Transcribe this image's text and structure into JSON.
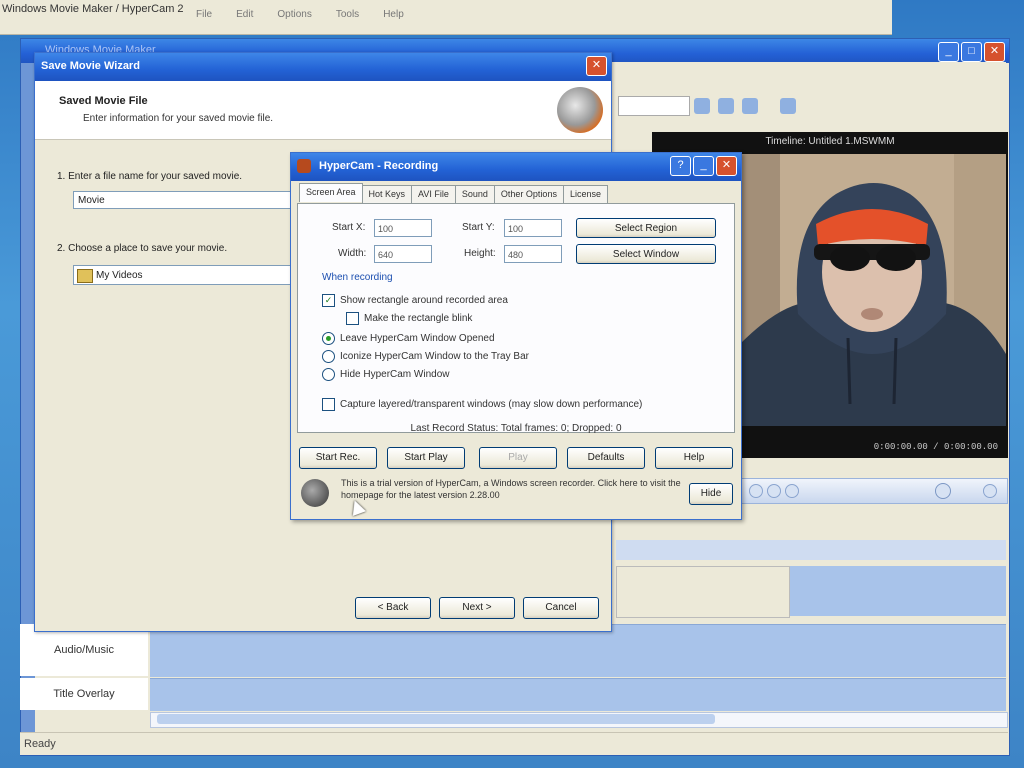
{
  "background_app": {
    "title": "Windows Movie Maker / HyperCam 2",
    "menu": [
      "File",
      "Edit",
      "Options",
      "Tools",
      "Help"
    ]
  },
  "movie_maker": {
    "window_title": "Windows Movie Maker",
    "monitor_title": "Timeline: Untitled 1.MSWMM",
    "timecode": "0:00:00.00 / 0:00:00.00",
    "tracks": [
      {
        "label": "Audio/Music"
      },
      {
        "label": "Title Overlay"
      }
    ],
    "status": "Ready"
  },
  "wizard": {
    "title": "Save Movie Wizard",
    "header_title": "Saved Movie File",
    "header_subtitle": "Enter information for your saved movie file.",
    "q1": "1. Enter a file name for your saved movie.",
    "filename": "Movie",
    "q2": "2. Choose a place to save your movie.",
    "location": "My Videos",
    "buttons": {
      "back": "< Back",
      "next": "Next >",
      "cancel": "Cancel"
    }
  },
  "hypercam": {
    "title": "HyperCam - Recording",
    "tabs": [
      "Screen Area",
      "Hot Keys",
      "AVI File",
      "Sound",
      "Other Options",
      "License"
    ],
    "fields": {
      "start_x_label": "Start X:",
      "start_x": "100",
      "start_y_label": "Start Y:",
      "start_y": "100",
      "width_label": "Width:",
      "width": "640",
      "height_label": "Height:",
      "height": "480"
    },
    "select_region": "Select Region",
    "select_window": "Select Window",
    "section_label": "When recording",
    "options": [
      {
        "label": "Show rectangle around recorded area",
        "type": "checkbox",
        "checked": true
      },
      {
        "label": "Make the rectangle blink",
        "type": "checkbox",
        "checked": false
      },
      {
        "label": "Leave HyperCam Window Opened",
        "type": "radio",
        "checked": true
      },
      {
        "label": "Iconize HyperCam Window to the Tray Bar",
        "type": "radio",
        "checked": false
      },
      {
        "label": "Hide HyperCam Window",
        "type": "radio",
        "checked": false
      },
      {
        "label": "Capture layered/transparent windows (may slow down performance)",
        "type": "checkbox",
        "checked": false
      }
    ],
    "last_status": "Last Record Status: Total frames: 0; Dropped: 0",
    "buttons": {
      "start_rec": "Start Rec.",
      "start_play": "Start Play",
      "play": "Play",
      "defaults": "Defaults",
      "help": "Help"
    },
    "footer_text": "This is a trial version of HyperCam, a Windows screen recorder. Click here to visit the homepage for the latest version 2.28.00",
    "footer_button": "Hide"
  }
}
